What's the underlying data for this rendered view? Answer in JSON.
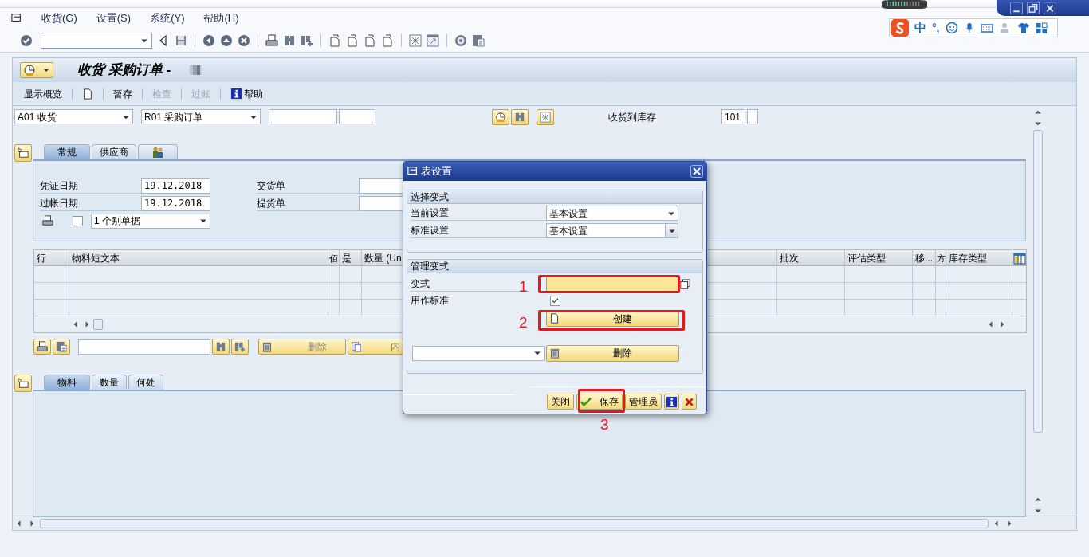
{
  "menu": [
    {
      "label": "收货(G)"
    },
    {
      "label": "设置(S)"
    },
    {
      "label": "系统(Y)"
    },
    {
      "label": "帮助(H)"
    }
  ],
  "title": "收货 采购订单 -",
  "app_toolbar": [
    {
      "kind": "text",
      "label": "显示概览",
      "disabled": false
    },
    {
      "kind": "new"
    },
    {
      "kind": "text",
      "label": "暂存",
      "disabled": false
    },
    {
      "kind": "text",
      "label": "检查",
      "disabled": true
    },
    {
      "kind": "text",
      "label": "过账",
      "disabled": true
    },
    {
      "kind": "info",
      "label": "帮助",
      "disabled": false
    }
  ],
  "header": {
    "action": "A01 收货",
    "reference": "R01 采购订单",
    "stock_label": "收货到库存",
    "movement_type": "101"
  },
  "top_tabs": [
    {
      "kind": "text",
      "label": "常规",
      "selected": true
    },
    {
      "kind": "text",
      "label": "供应商",
      "selected": false
    },
    {
      "kind": "icon",
      "selected": false
    }
  ],
  "general": {
    "fields": [
      {
        "label": "凭证日期",
        "value": "19.12.2018"
      },
      {
        "label": "过帐日期",
        "value": "19.12.2018"
      }
    ],
    "right_fields": [
      {
        "label": "交货单"
      },
      {
        "label": "提货单"
      }
    ],
    "print_checked": false,
    "print_option": "1 个别单据"
  },
  "items_table": {
    "columns": [
      {
        "label": "行"
      },
      {
        "label": "物料短文本"
      },
      {
        "label": "佰"
      },
      {
        "label": "是"
      },
      {
        "label": "数量 (Un"
      },
      {
        "label": "批次"
      },
      {
        "label": "评估类型"
      },
      {
        "label": "移..."
      },
      {
        "label": "方"
      },
      {
        "label": "库存类型"
      }
    ]
  },
  "item_toolbar": {
    "delete": "删除",
    "contents": "内"
  },
  "bottom_tabs": [
    {
      "label": "物料",
      "selected": true
    },
    {
      "label": "数量",
      "selected": false
    },
    {
      "label": "何处",
      "selected": false
    }
  ],
  "dialog": {
    "title": "表设置",
    "select_group": {
      "title": "选择变式",
      "rows": [
        {
          "label": "当前设置",
          "value": "基本设置"
        },
        {
          "label": "标准设置",
          "value": "基本设置"
        }
      ]
    },
    "manage_group": {
      "title": "管理变式",
      "variant_label": "变式",
      "default_label": "用作标准",
      "default_checked": true,
      "create": "创建",
      "delete": "删除"
    },
    "buttons": [
      {
        "kind": "text",
        "label": "关闭"
      },
      {
        "kind": "check",
        "label": "保存"
      },
      {
        "kind": "text",
        "label": "管理员"
      },
      {
        "kind": "info"
      },
      {
        "kind": "cancel"
      }
    ]
  },
  "annotations": [
    {
      "kind": "field",
      "label": "1"
    },
    {
      "kind": "create",
      "label": "2"
    },
    {
      "kind": "save",
      "label": "3"
    }
  ],
  "ime": {
    "mode": "中",
    "punctuation": "°,"
  }
}
